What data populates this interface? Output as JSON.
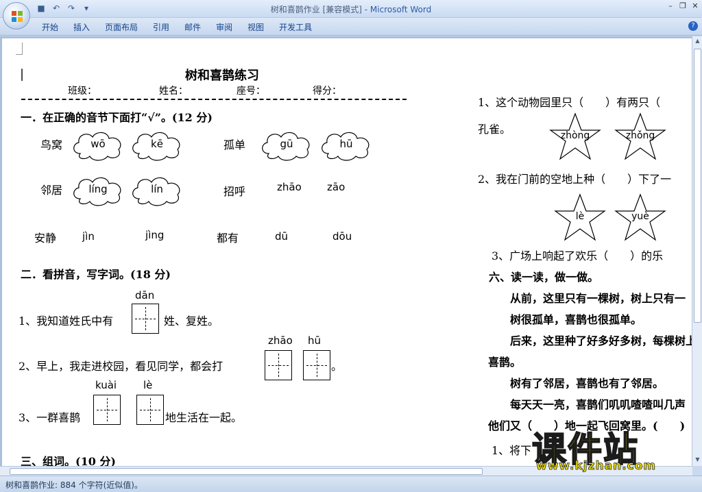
{
  "window": {
    "title_doc": "树和喜鹊作业 [兼容模式] - ",
    "title_app": "Microsoft Word",
    "tabs": [
      "开始",
      "插入",
      "页面布局",
      "引用",
      "邮件",
      "审阅",
      "视图",
      "开发工具"
    ]
  },
  "status": {
    "text": "树和喜鹊作业: 884 个字符(近似值)。"
  },
  "doc": {
    "title": "树和喜鹊练习",
    "info": {
      "class": "班级：",
      "name": "姓名：",
      "seat": "座号：",
      "score": "得分："
    },
    "s1": {
      "heading": "一．在正确的音节下面打“√”。(12 分)",
      "rows": [
        {
          "word": "鸟窝",
          "opts": [
            "wō",
            "kē"
          ]
        },
        {
          "word": "孤单",
          "opts": [
            "gū",
            "hū"
          ]
        },
        {
          "word": "邻居",
          "opts": [
            "líng",
            "lín"
          ]
        },
        {
          "word": "招呼",
          "opts": [
            "zhāo",
            "zāo"
          ]
        },
        {
          "word": "安静",
          "opts": [
            "jìn",
            "jìng"
          ]
        },
        {
          "word": "都有",
          "opts": [
            "dū",
            "dōu"
          ]
        }
      ]
    },
    "s2": {
      "heading": "二．看拼音，写字词。(18 分)",
      "q1": {
        "pinyin": "dān",
        "before": "1、我知道姓氏中有",
        "after": "姓、复姓。"
      },
      "q2": {
        "pinyin1": "zhāo",
        "pinyin2": "hū",
        "before": "2、早上，我走进校园，看见同学，都会打",
        "after": "。"
      },
      "q3": {
        "pinyin1": "kuài",
        "pinyin2": "lè",
        "before": "3、一群喜鹊",
        "after": "地生活在一起。"
      }
    },
    "s3": {
      "heading": "三、组词。(10 分)"
    },
    "right": {
      "q1": "1、这个动物园里只（　　）有两只（",
      "q1b": "孔雀。",
      "star1": "zhòng",
      "star2": "zhǒng",
      "q2": "2、我在门前的空地上种（　　）下了一",
      "star3": "lè",
      "star4": "yuè",
      "q3": "3、广场上响起了欢乐（　　）的乐",
      "s6": "六、读一读，做一做。",
      "p1": "从前，这里只有一棵树，树上只有一",
      "p2": "树很孤单，喜鹊也很孤单。",
      "p3": "后来，这里种了好多好多树，每棵树上",
      "p3b": "喜鹊。",
      "p4": "树有了邻居，喜鹊也有了邻居。",
      "p5": "每天天一亮，喜鹊们叽叽喳喳叫几声",
      "p6": "他们又（　　）地一起飞回窝里。(　　)",
      "q_last": "1、将下"
    }
  },
  "watermark": {
    "big": "课件站",
    "small": "www.kjzhan.com"
  }
}
